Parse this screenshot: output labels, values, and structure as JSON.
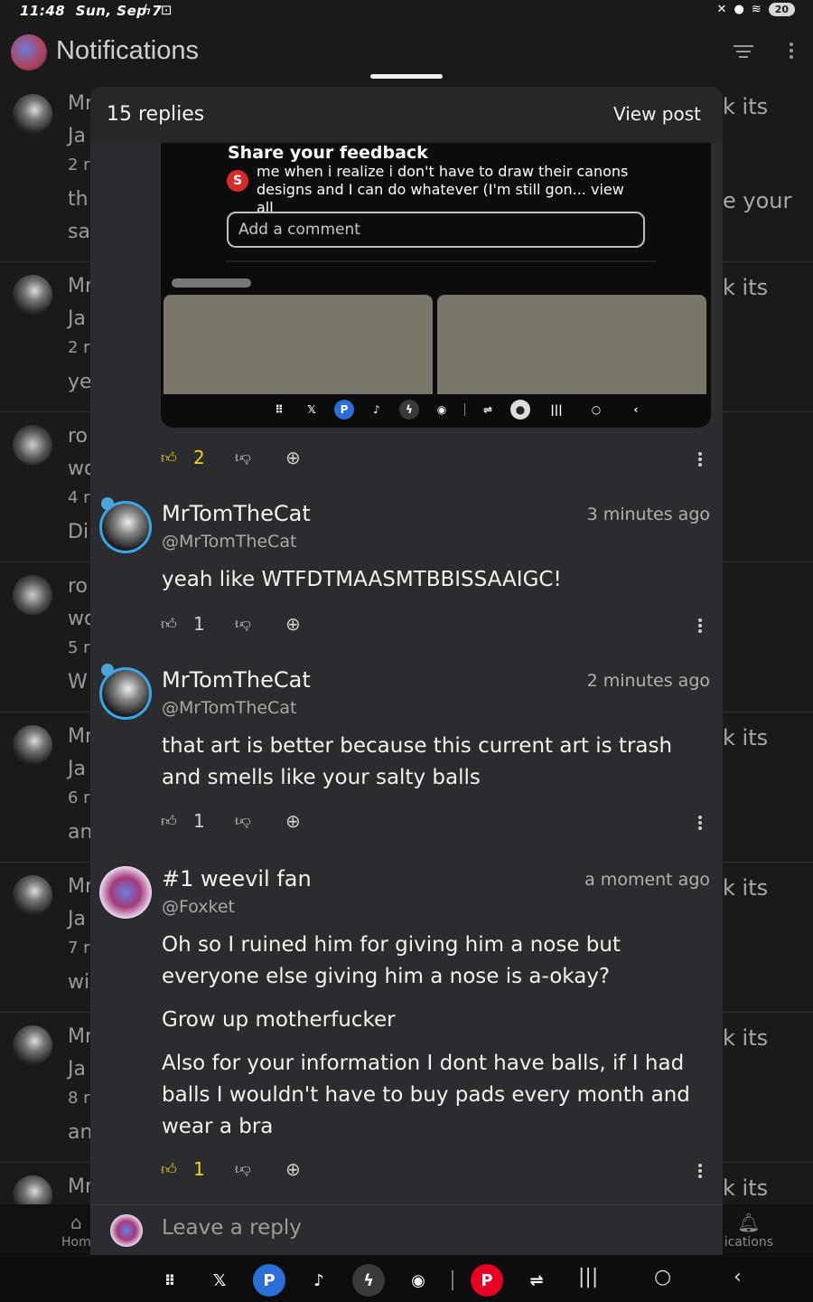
{
  "status_bar": {
    "time": "11:48",
    "date": "Sun, Sep 7",
    "battery": "20"
  },
  "app": {
    "title": "Notifications",
    "notifications": [
      {
        "lines": [
          "Mr",
          "Ja",
          "2 r",
          "th",
          "sa"
        ],
        "right": "k its"
      },
      {
        "lines": [
          "Mr",
          "Ja",
          "2 r",
          "ye"
        ],
        "right": "k its"
      },
      {
        "lines": [
          "ro",
          "wo",
          "4 r",
          "Di"
        ],
        "right": ""
      },
      {
        "lines": [
          "ro",
          "wo",
          "5 r",
          "W"
        ],
        "right": ""
      },
      {
        "lines": [
          "Mr",
          "Ja",
          "6 r",
          "an"
        ],
        "right": "k its"
      },
      {
        "lines": [
          "Mr",
          "Ja",
          "7 r",
          "wi"
        ],
        "right": "k its"
      },
      {
        "lines": [
          "Mr",
          "Ja",
          "8 r",
          "an"
        ],
        "right": "k its"
      },
      {
        "lines": [
          "Mr"
        ],
        "right": "k its"
      }
    ],
    "notif_extra_right": "e your",
    "nav": {
      "home": "Hom",
      "notifications": "ications"
    }
  },
  "sheet": {
    "replies_count": "15 replies",
    "view_post": "View post",
    "embed": {
      "title": "Share your feedback",
      "badge": "S",
      "text": "me when i realize i don't have to draw their canons designs and I can do whatever (I'm still gon... view all",
      "input_placeholder": "Add a comment"
    },
    "post_actions": {
      "likes": "2",
      "liked": true
    },
    "comments": [
      {
        "name": "MrTomTheCat",
        "handle": "@MrTomTheCat",
        "time": "3 minutes ago",
        "body": [
          "yeah like WTFDTMAASMTBBISSAAIGC!"
        ],
        "likes": "1",
        "liked": false
      },
      {
        "name": "MrTomTheCat",
        "handle": "@MrTomTheCat",
        "time": "2 minutes ago",
        "body": [
          "that art is better because this current art is trash and smells like your salty balls"
        ],
        "likes": "1",
        "liked": false
      },
      {
        "name": "#1 weevil fan",
        "handle": "@Foxket",
        "time": "a moment ago",
        "body": [
          "Oh so I ruined him for giving him a nose but everyone else giving him a nose is a-okay?",
          "Grow up motherfucker",
          "Also for your information I dont have balls, if I had balls I wouldn't have to buy pads every month and wear a bra"
        ],
        "likes": "1",
        "liked": true
      }
    ],
    "reply_placeholder": "Leave a reply"
  },
  "colors": {
    "accent_like": "#f3d21c",
    "sheet_bg": "#2b2c30",
    "avatar_ring": "#3aa7e6",
    "pinterest": "#e60023"
  },
  "icons": {
    "dock": [
      "apps-grid-icon",
      "x-icon",
      "picsart-icon",
      "tiktok-icon",
      "bolt-icon",
      "discord-icon",
      "pinterest-icon",
      "flow-icon"
    ]
  }
}
